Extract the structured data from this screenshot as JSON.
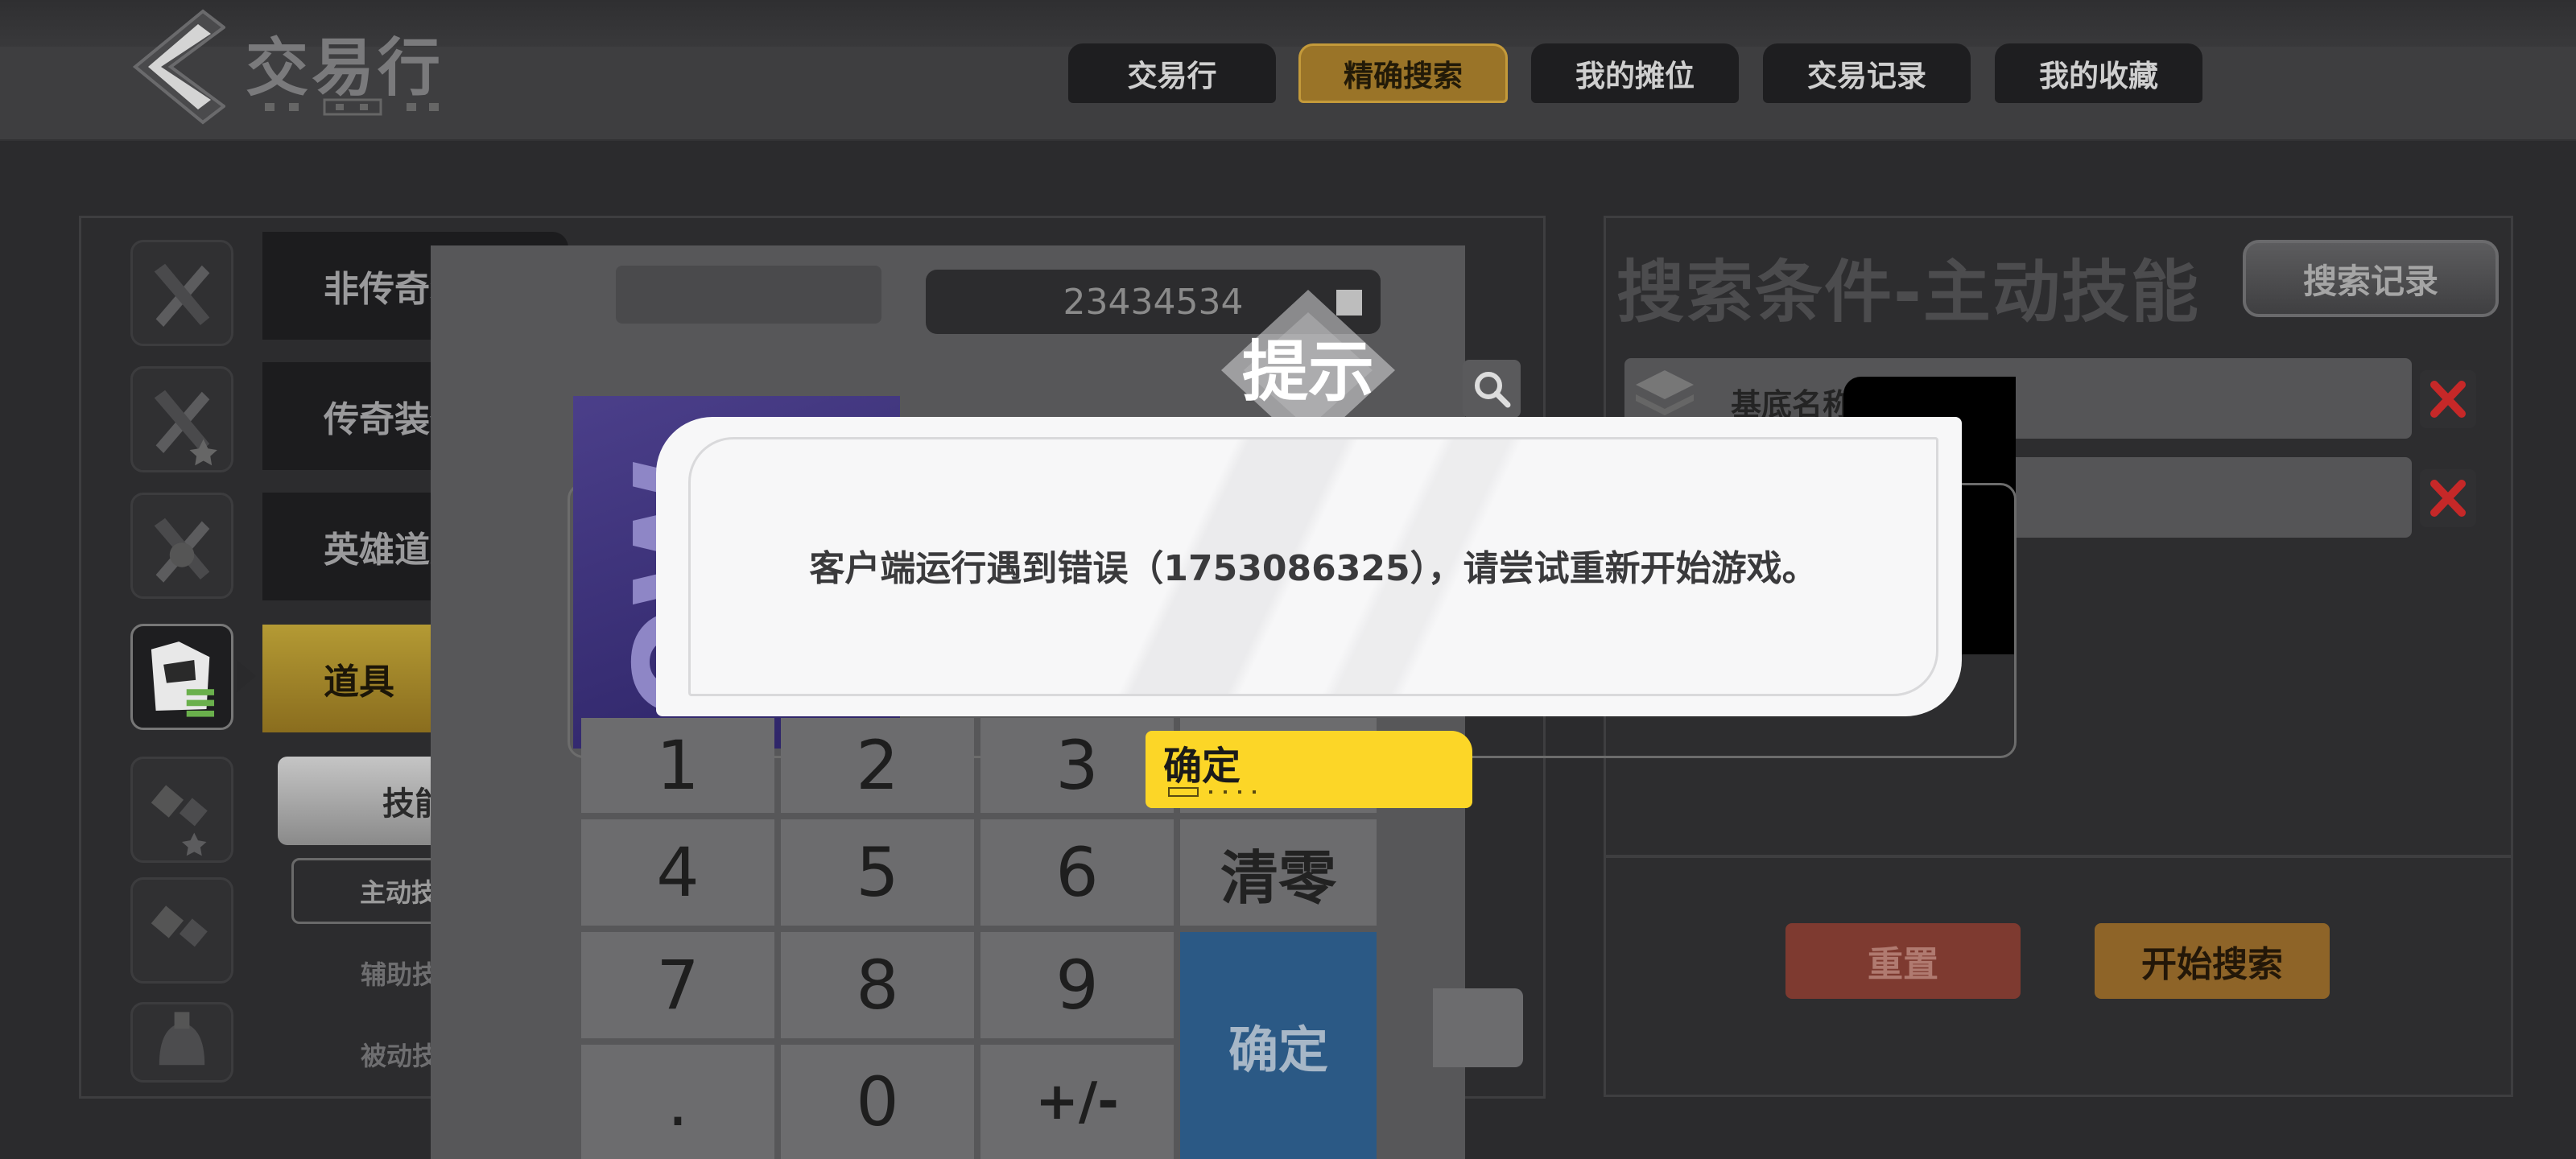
{
  "header": {
    "title": "交易行",
    "tabs": [
      {
        "label": "交易行",
        "active": false
      },
      {
        "label": "精确搜索",
        "active": true
      },
      {
        "label": "我的摊位",
        "active": false
      },
      {
        "label": "交易记录",
        "active": false
      },
      {
        "label": "我的收藏",
        "active": false
      }
    ]
  },
  "sidebar": {
    "categories": [
      {
        "label": "非传奇装备",
        "icon": "crossed-blades-icon"
      },
      {
        "label": "传奇装备",
        "icon": "legendary-blades-icon"
      },
      {
        "label": "英雄道具",
        "icon": "hero-item-icon"
      },
      {
        "label": "道具",
        "icon": "item-bag-icon",
        "active": true
      }
    ],
    "sub": {
      "skill": "技能",
      "items": [
        "主动技能",
        "辅助技能",
        "被动技能"
      ]
    }
  },
  "keypad": {
    "display_value": "23434534",
    "keys": [
      "1",
      "2",
      "3",
      "4",
      "5",
      "6",
      "清零",
      "7",
      "8",
      "9",
      "确定",
      ".",
      "0",
      "+/-"
    ],
    "promo_text": "NOW"
  },
  "search_panel": {
    "title": "搜索条件-主动技能",
    "history_button": "搜索记录",
    "condition_label": "基底名称",
    "reset_button": "重置",
    "start_button": "开始搜索"
  },
  "alert": {
    "title": "提示",
    "message": "客户端运行遇到错误（1753086325），请尝试重新开始游戏。",
    "ok_button": "确定"
  },
  "colors": {
    "accent_gold": "#9a7428",
    "confirm_yellow": "#fcd627",
    "keypad_confirm_blue": "#2b5985",
    "reset_red": "#7e3a30",
    "clear_x_red": "#c62828"
  }
}
